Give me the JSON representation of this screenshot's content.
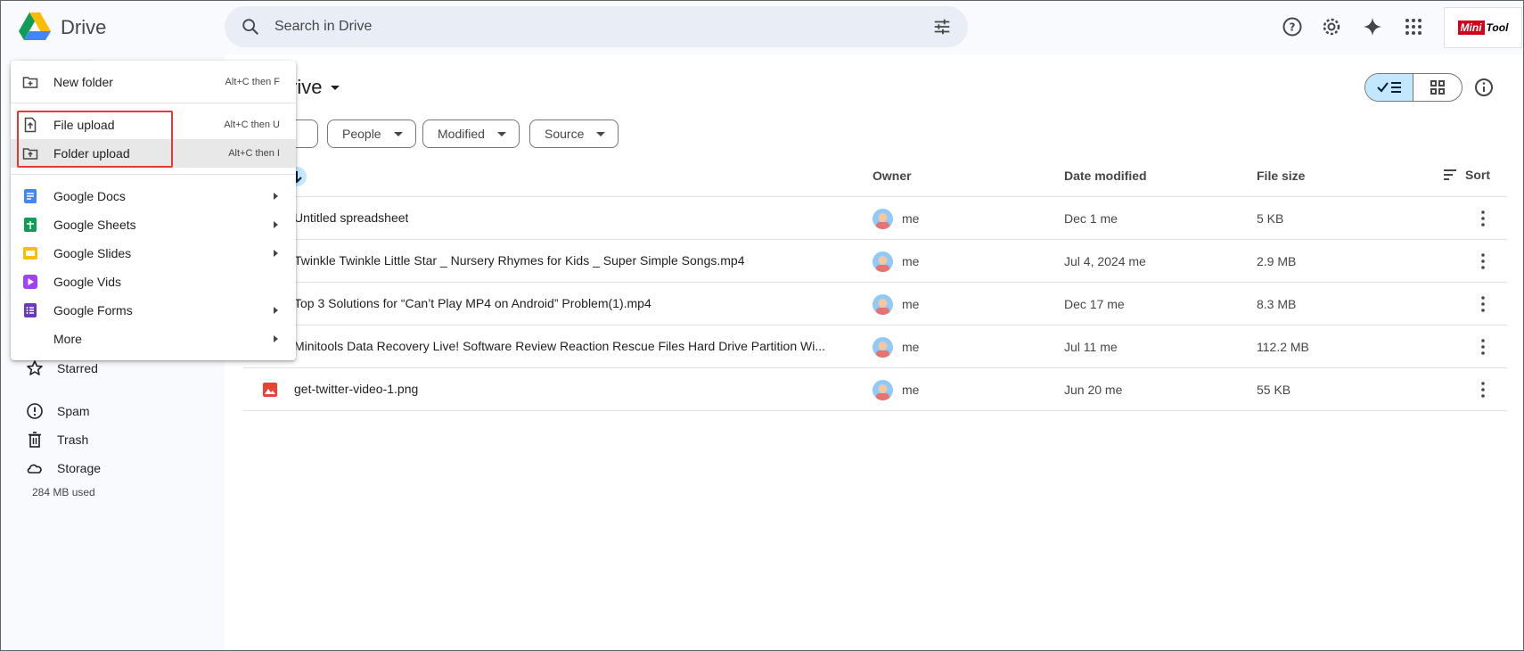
{
  "app": {
    "name": "Drive"
  },
  "search": {
    "placeholder": "Search in Drive"
  },
  "brand": {
    "part1": "Mini",
    "part2": "Tool"
  },
  "header": {
    "title": "rive"
  },
  "filters": [
    {
      "label": "People"
    },
    {
      "label": "Modified"
    },
    {
      "label": "Source"
    }
  ],
  "columns": {
    "owner": "Owner",
    "date_modified": "Date modified",
    "file_size": "File size",
    "sort": "Sort"
  },
  "files": [
    {
      "name": "Untitled spreadsheet",
      "owner": "me",
      "date": "Dec 1 me",
      "size": "5 KB"
    },
    {
      "name": "Twinkle Twinkle Little Star _ Nursery Rhymes for Kids _ Super Simple Songs.mp4",
      "owner": "me",
      "date": "Jul 4, 2024 me",
      "size": "2.9 MB"
    },
    {
      "name": "Top 3 Solutions for “Can’t Play MP4 on Android” Problem(1).mp4",
      "owner": "me",
      "date": "Dec 17 me",
      "size": "8.3 MB"
    },
    {
      "name": "Minitools Data Recovery Live! Software Review Reaction Rescue Files Hard Drive Partition Wi...",
      "owner": "me",
      "date": "Jul 11 me",
      "size": "112.2 MB"
    },
    {
      "name": "get-twitter-video-1.png",
      "owner": "me",
      "date": "Jun 20 me",
      "size": "55 KB"
    }
  ],
  "sidebar": {
    "items": [
      {
        "label": "Starred"
      },
      {
        "label": "Spam"
      },
      {
        "label": "Trash"
      },
      {
        "label": "Storage"
      }
    ],
    "storage_used": "284 MB used"
  },
  "menu": {
    "new_folder": {
      "label": "New folder",
      "shortcut": "Alt+C then F"
    },
    "file_upload": {
      "label": "File upload",
      "shortcut": "Alt+C then U"
    },
    "folder_upload": {
      "label": "Folder upload",
      "shortcut": "Alt+C then I"
    },
    "docs": {
      "label": "Google Docs"
    },
    "sheets": {
      "label": "Google Sheets"
    },
    "slides": {
      "label": "Google Slides"
    },
    "vids": {
      "label": "Google Vids"
    },
    "forms": {
      "label": "Google Forms"
    },
    "more": {
      "label": "More"
    }
  },
  "colors": {
    "accent": "#0b57d0",
    "highlight_box": "#e53935",
    "selected_view": "#c2e7ff"
  }
}
